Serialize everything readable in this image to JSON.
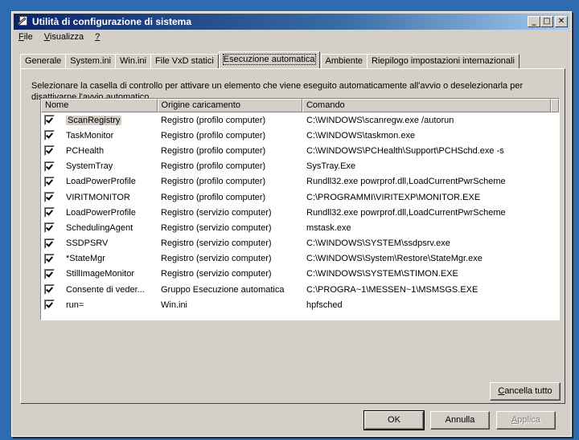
{
  "window": {
    "title": "Utilità di configurazione di sistema"
  },
  "caption_buttons": {
    "minimize": "_",
    "maximize": "□",
    "close": "✕"
  },
  "menu": [
    {
      "label": "File",
      "ul": "F",
      "rest": "ile"
    },
    {
      "label": "Visualizza",
      "ul": "V",
      "rest": "isualizza"
    },
    {
      "label": "?",
      "ul": "?",
      "rest": ""
    }
  ],
  "tabs": [
    "Generale",
    "System.ini",
    "Win.ini",
    "File VxD statici",
    "Esecuzione automatica",
    "Ambiente",
    "Riepilogo impostazioni internazionali"
  ],
  "active_tab": "Esecuzione automatica",
  "description": "Selezionare la casella di controllo per attivare un elemento che viene eseguito automaticamente all'avvio o deselezionarla per disattivarne l'avvio automatico.",
  "list": {
    "columns": [
      "Nome",
      "Origine caricamento",
      "Comando"
    ],
    "rows": [
      {
        "checked": true,
        "name": "ScanRegistry",
        "origin": "Registro (profilo computer)",
        "command": "C:\\WINDOWS\\scanregw.exe /autorun"
      },
      {
        "checked": true,
        "name": "TaskMonitor",
        "origin": "Registro (profilo computer)",
        "command": "C:\\WINDOWS\\taskmon.exe"
      },
      {
        "checked": true,
        "name": "PCHealth",
        "origin": "Registro (profilo computer)",
        "command": "C:\\WINDOWS\\PCHealth\\Support\\PCHSchd.exe -s"
      },
      {
        "checked": true,
        "name": "SystemTray",
        "origin": "Registro (profilo computer)",
        "command": "SysTray.Exe"
      },
      {
        "checked": true,
        "name": "LoadPowerProfile",
        "origin": "Registro (profilo computer)",
        "command": "Rundll32.exe powrprof.dll,LoadCurrentPwrScheme"
      },
      {
        "checked": true,
        "name": "VIRITMONITOR",
        "origin": "Registro (profilo computer)",
        "command": "C:\\PROGRAMMI\\VIRITEXP\\MONITOR.EXE"
      },
      {
        "checked": true,
        "name": "LoadPowerProfile",
        "origin": "Registro (servizio computer)",
        "command": "Rundll32.exe powrprof.dll,LoadCurrentPwrScheme"
      },
      {
        "checked": true,
        "name": "SchedulingAgent",
        "origin": "Registro (servizio computer)",
        "command": "mstask.exe"
      },
      {
        "checked": true,
        "name": "SSDPSRV",
        "origin": "Registro (servizio computer)",
        "command": "C:\\WINDOWS\\SYSTEM\\ssdpsrv.exe"
      },
      {
        "checked": true,
        "name": "*StateMgr",
        "origin": "Registro (servizio computer)",
        "command": "C:\\WINDOWS\\System\\Restore\\StateMgr.exe"
      },
      {
        "checked": true,
        "name": "StillImageMonitor",
        "origin": "Registro (servizio computer)",
        "command": "C:\\WINDOWS\\SYSTEM\\STIMON.EXE"
      },
      {
        "checked": true,
        "name": "Consente di veder...",
        "origin": "Gruppo Esecuzione automatica",
        "command": "C:\\PROGRA~1\\MESSEN~1\\MSMSGS.EXE"
      },
      {
        "checked": true,
        "name": "run=",
        "origin": "Win.ini",
        "command": "hpfsched"
      }
    ]
  },
  "buttons": {
    "clear_all": {
      "ul": "C",
      "rest": "ancella tutto"
    },
    "ok": "OK",
    "cancel": "Annulla",
    "apply": {
      "ul": "A",
      "rest": "pplica"
    }
  }
}
